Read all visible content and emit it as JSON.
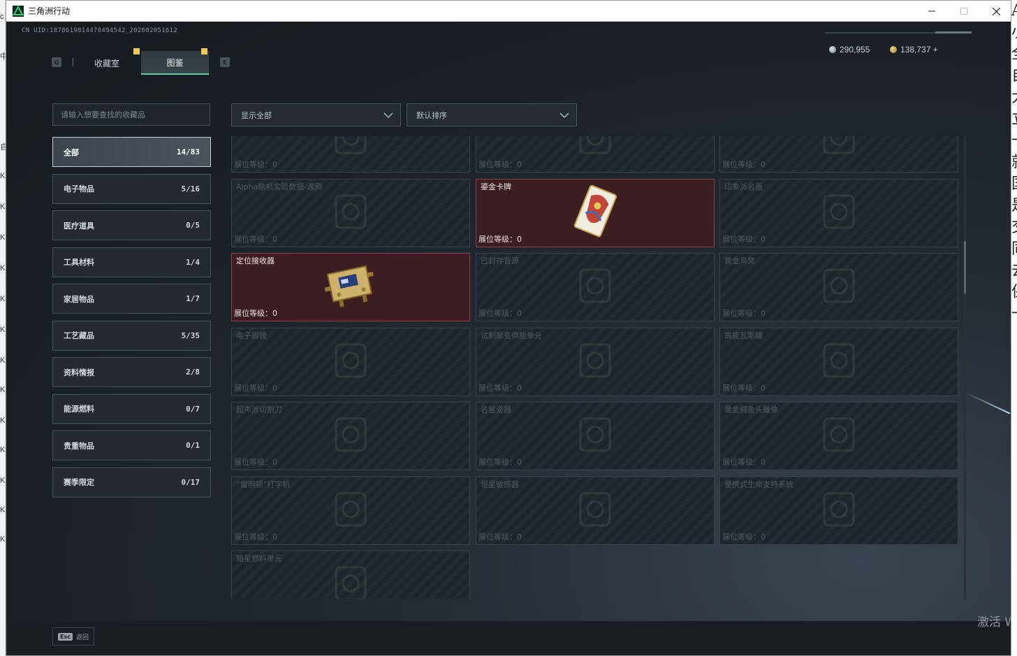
{
  "window": {
    "title": "三角洲行动"
  },
  "desktop": {
    "left_chars": [
      "c",
      "中",
      "自",
      "K",
      "K",
      "K",
      "K",
      "K",
      "K",
      "K",
      "K",
      "K",
      "K",
      "K",
      "K",
      "K",
      "K"
    ],
    "right_chars": [
      "A",
      "小",
      "全",
      "自",
      "大",
      "立",
      "一",
      "就",
      "国",
      "是",
      "交",
      "同",
      "去",
      "保",
      "一"
    ]
  },
  "header": {
    "uid": "CN UID:1878619814470494 54 2_202602051612",
    "currency": [
      {
        "value": "290,955",
        "color": "#b9c0c5"
      },
      {
        "value": "138,737 +",
        "color": "#d6b86a"
      }
    ]
  },
  "tabs": {
    "prev_key": "Q",
    "next_key": "E",
    "items": [
      {
        "label": "收藏室",
        "active": false
      },
      {
        "label": "图鉴",
        "active": true
      }
    ]
  },
  "search": {
    "placeholder": "请输入想要查找的收藏品"
  },
  "categories": [
    {
      "label": "全部",
      "count": "14/83",
      "active": true
    },
    {
      "label": "电子物品",
      "count": "5/16",
      "active": false
    },
    {
      "label": "医疗道具",
      "count": "0/5",
      "active": false
    },
    {
      "label": "工具材料",
      "count": "1/4",
      "active": false
    },
    {
      "label": "家居物品",
      "count": "1/7",
      "active": false
    },
    {
      "label": "工艺藏品",
      "count": "5/35",
      "active": false
    },
    {
      "label": "资料情报",
      "count": "2/8",
      "active": false
    },
    {
      "label": "能源燃料",
      "count": "0/7",
      "active": false
    },
    {
      "label": "贵重物品",
      "count": "0/1",
      "active": false
    },
    {
      "label": "赛季限定",
      "count": "0/17",
      "active": false
    }
  ],
  "filters": {
    "show": "显示全部",
    "sort": "默认排序"
  },
  "level_label": "展位等级：",
  "items": [
    {
      "name": "",
      "level": "0",
      "owned": false,
      "icon": "ring-icon"
    },
    {
      "name": "",
      "level": "0",
      "owned": false,
      "icon": "device-icon"
    },
    {
      "name": "",
      "level": "0",
      "owned": false,
      "icon": "frame-icon"
    },
    {
      "name": "Alpha脑机实验数据-渡鸦",
      "level": "0",
      "owned": false,
      "icon": "drive-icon"
    },
    {
      "name": "鎏金卡牌",
      "level": "0",
      "owned": true,
      "icon": "card-icon"
    },
    {
      "name": "印象派名画",
      "level": "0",
      "owned": false,
      "icon": "frame-icon"
    },
    {
      "name": "定位接收器",
      "level": "0",
      "owned": true,
      "icon": "receiver-icon"
    },
    {
      "name": "已封存音源",
      "level": "0",
      "owned": false,
      "icon": "device-icon"
    },
    {
      "name": "黄金鸟窝",
      "level": "0",
      "owned": false,
      "icon": "nest-icon"
    },
    {
      "name": "电子脚镣",
      "level": "0",
      "owned": false,
      "icon": "anklet-icon"
    },
    {
      "name": "试制聚变供能单元",
      "level": "0",
      "owned": false,
      "icon": "cell-icon"
    },
    {
      "name": "高能瓦斯罐",
      "level": "0",
      "owned": false,
      "icon": "canister-icon"
    },
    {
      "name": "超声波切割刀",
      "level": "0",
      "owned": false,
      "icon": "knife-icon"
    },
    {
      "name": "名窑瓷器",
      "level": "0",
      "owned": false,
      "icon": "vase-icon"
    },
    {
      "name": "黄金鳄鱼头雕像",
      "level": "0",
      "owned": false,
      "icon": "statue-icon"
    },
    {
      "name": "“雷明顿”打字机",
      "level": "0",
      "owned": false,
      "icon": "typewriter-icon"
    },
    {
      "name": "恒星敏感器",
      "level": "0",
      "owned": false,
      "icon": "sensor-icon"
    },
    {
      "name": "便携式生命支持系统",
      "level": "0",
      "owned": false,
      "icon": "backpack-icon"
    },
    {
      "name": "暗星燃料单元",
      "level": "",
      "owned": false,
      "icon": "fuel-icon"
    }
  ],
  "footer": {
    "esc_key": "Esc",
    "back_label": "返回"
  },
  "watermark": "激活 W"
}
